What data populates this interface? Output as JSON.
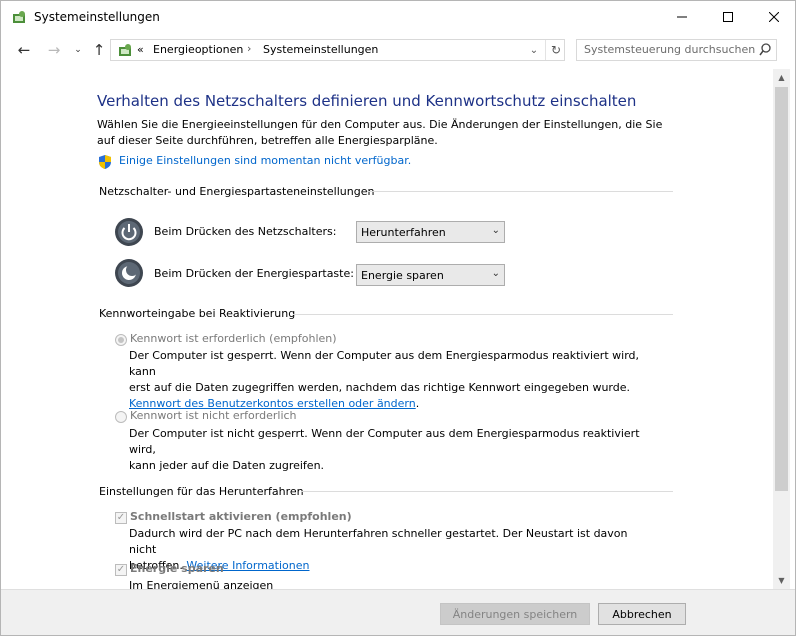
{
  "window": {
    "title": "Systemeinstellungen"
  },
  "nav": {
    "breadcrumb": [
      "Energieoptionen",
      "Systemeinstellungen"
    ],
    "prefix": "«",
    "search_placeholder": "Systemsteuerung durchsuchen"
  },
  "main": {
    "heading": "Verhalten des Netzschalters definieren und Kennwortschutz einschalten",
    "intro": "Wählen Sie die Energieeinstellungen für den Computer aus. Die Änderungen der Einstellungen, die Sie auf dieser Seite durchführen, betreffen alle Energiesparpläne.",
    "unavailable_link": "Einige Einstellungen sind momentan nicht verfügbar."
  },
  "power_section": {
    "title": "Netzschalter- und Energiespartasteneinstellungen",
    "power_button_label": "Beim Drücken des Netzschalters:",
    "power_button_value": "Herunterfahren",
    "sleep_button_label": "Beim Drücken der Energiespartaste:",
    "sleep_button_value": "Energie sparen"
  },
  "password_section": {
    "title": "Kennworteingabe bei Reaktivierung",
    "opt_required_label": "Kennwort ist erforderlich (empfohlen)",
    "opt_required_desc1": "Der Computer ist gesperrt. Wenn der Computer aus dem Energiesparmodus reaktiviert wird, kann",
    "opt_required_desc2": "erst auf die Daten zugegriffen werden, nachdem das richtige Kennwort eingegeben wurde.",
    "account_link": "Kennwort des Benutzerkontos erstellen oder ändern",
    "account_link_suffix": ".",
    "opt_not_required_label": "Kennwort ist nicht erforderlich",
    "opt_not_required_desc1": "Der Computer ist nicht gesperrt. Wenn der Computer aus dem Energiesparmodus reaktiviert wird,",
    "opt_not_required_desc2": "kann jeder auf die Daten zugreifen."
  },
  "shutdown_section": {
    "title": "Einstellungen für das Herunterfahren",
    "fast_startup_label": "Schnellstart aktivieren (empfohlen)",
    "fast_startup_desc1": "Dadurch wird der PC nach dem Herunterfahren schneller gestartet. Der Neustart ist davon nicht",
    "fast_startup_desc2": "betroffen.",
    "more_info_link": "Weitere Informationen",
    "sleep_label": "Energie sparen",
    "sleep_desc": "Im Energiemenü anzeigen"
  },
  "footer": {
    "save_label": "Änderungen speichern",
    "cancel_label": "Abbrechen"
  }
}
